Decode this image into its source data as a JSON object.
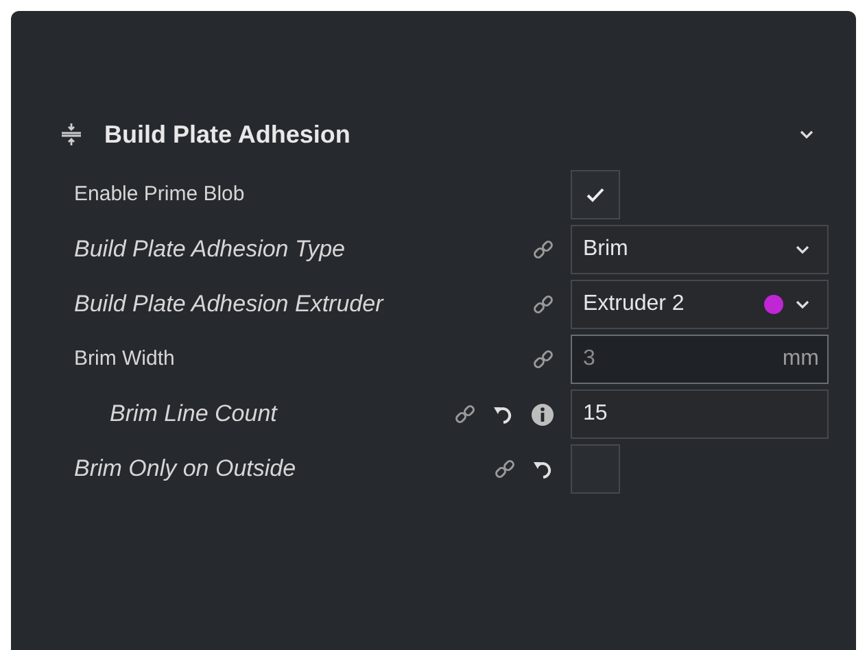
{
  "section": {
    "title": "Build Plate Adhesion",
    "expanded": true
  },
  "settings": [
    {
      "label": "Enable Prime Blob",
      "italic": false,
      "linked": false,
      "reset": false,
      "info": false,
      "kind": "checkbox",
      "checked": true
    },
    {
      "label": "Build Plate Adhesion Type",
      "italic": true,
      "linked": true,
      "reset": false,
      "info": false,
      "kind": "dropdown",
      "value": "Brim"
    },
    {
      "label": "Build Plate Adhesion Extruder",
      "italic": true,
      "linked": true,
      "reset": false,
      "info": false,
      "kind": "dropdown",
      "value": "Extruder 2",
      "color": "#c026d3"
    },
    {
      "label": "Brim Width",
      "italic": false,
      "linked": true,
      "reset": false,
      "info": false,
      "kind": "number",
      "value": "3",
      "unit": "mm",
      "disabled": true,
      "children": [
        {
          "label": "Brim Line Count",
          "italic": true,
          "linked": true,
          "reset": true,
          "info": true,
          "kind": "number",
          "value": "15",
          "disabled": false
        }
      ]
    },
    {
      "label": "Brim Only on Outside",
      "italic": true,
      "linked": true,
      "reset": true,
      "info": false,
      "kind": "checkbox",
      "checked": false
    }
  ]
}
